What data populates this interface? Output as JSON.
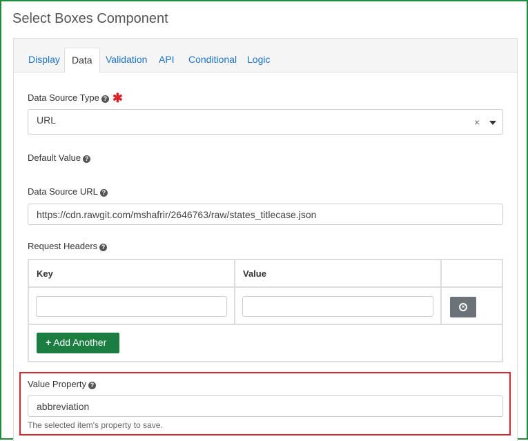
{
  "window": {
    "title": "Select Boxes Component"
  },
  "tabs": [
    {
      "label": "Display"
    },
    {
      "label": "Data"
    },
    {
      "label": "Validation"
    },
    {
      "label": "API"
    },
    {
      "label": "Conditional"
    },
    {
      "label": "Logic"
    }
  ],
  "active_tab": "Data",
  "data_source_type": {
    "label": "Data Source Type",
    "required_marker": "✱",
    "value": "URL",
    "clear_glyph": "×"
  },
  "default_value": {
    "label": "Default Value"
  },
  "data_source_url": {
    "label": "Data Source URL",
    "value": "https://cdn.rawgit.com/mshafrir/2646763/raw/states_titlecase.json"
  },
  "request_headers": {
    "label": "Request Headers",
    "columns": [
      "Key",
      "Value"
    ],
    "rows": [
      {
        "key": "",
        "value": ""
      }
    ],
    "add_label": "Add Another",
    "add_icon": "plus-icon",
    "remove_icon": "remove-circle-icon"
  },
  "value_property": {
    "label": "Value Property",
    "value": "abbreviation",
    "help": "The selected item's property to save."
  },
  "help_icon": "question-circle-icon",
  "colors": {
    "frame_border": "#1e8c3a",
    "highlight_border": "#d9232d",
    "link": "#1a73c8",
    "add_button": "#1b7d3f",
    "remove_button": "#6b7278",
    "required": "#d9232d"
  }
}
